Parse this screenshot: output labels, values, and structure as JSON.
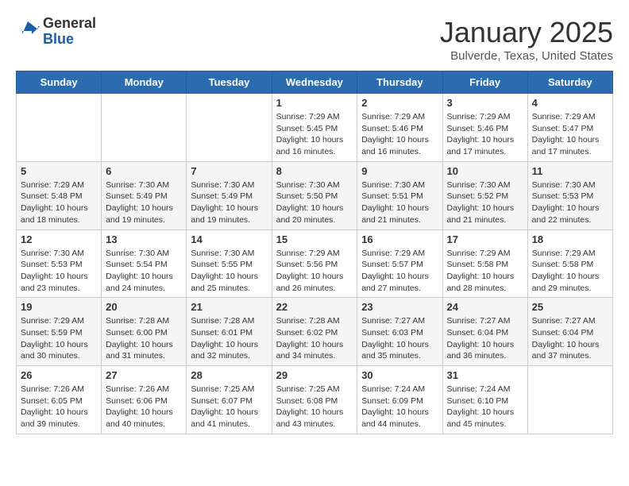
{
  "header": {
    "logo_general": "General",
    "logo_blue": "Blue",
    "month_title": "January 2025",
    "location": "Bulverde, Texas, United States"
  },
  "days_of_week": [
    "Sunday",
    "Monday",
    "Tuesday",
    "Wednesday",
    "Thursday",
    "Friday",
    "Saturday"
  ],
  "weeks": [
    [
      {
        "day": "",
        "info": ""
      },
      {
        "day": "",
        "info": ""
      },
      {
        "day": "",
        "info": ""
      },
      {
        "day": "1",
        "info": "Sunrise: 7:29 AM\nSunset: 5:45 PM\nDaylight: 10 hours\nand 16 minutes."
      },
      {
        "day": "2",
        "info": "Sunrise: 7:29 AM\nSunset: 5:46 PM\nDaylight: 10 hours\nand 16 minutes."
      },
      {
        "day": "3",
        "info": "Sunrise: 7:29 AM\nSunset: 5:46 PM\nDaylight: 10 hours\nand 17 minutes."
      },
      {
        "day": "4",
        "info": "Sunrise: 7:29 AM\nSunset: 5:47 PM\nDaylight: 10 hours\nand 17 minutes."
      }
    ],
    [
      {
        "day": "5",
        "info": "Sunrise: 7:29 AM\nSunset: 5:48 PM\nDaylight: 10 hours\nand 18 minutes."
      },
      {
        "day": "6",
        "info": "Sunrise: 7:30 AM\nSunset: 5:49 PM\nDaylight: 10 hours\nand 19 minutes."
      },
      {
        "day": "7",
        "info": "Sunrise: 7:30 AM\nSunset: 5:49 PM\nDaylight: 10 hours\nand 19 minutes."
      },
      {
        "day": "8",
        "info": "Sunrise: 7:30 AM\nSunset: 5:50 PM\nDaylight: 10 hours\nand 20 minutes."
      },
      {
        "day": "9",
        "info": "Sunrise: 7:30 AM\nSunset: 5:51 PM\nDaylight: 10 hours\nand 21 minutes."
      },
      {
        "day": "10",
        "info": "Sunrise: 7:30 AM\nSunset: 5:52 PM\nDaylight: 10 hours\nand 21 minutes."
      },
      {
        "day": "11",
        "info": "Sunrise: 7:30 AM\nSunset: 5:53 PM\nDaylight: 10 hours\nand 22 minutes."
      }
    ],
    [
      {
        "day": "12",
        "info": "Sunrise: 7:30 AM\nSunset: 5:53 PM\nDaylight: 10 hours\nand 23 minutes."
      },
      {
        "day": "13",
        "info": "Sunrise: 7:30 AM\nSunset: 5:54 PM\nDaylight: 10 hours\nand 24 minutes."
      },
      {
        "day": "14",
        "info": "Sunrise: 7:30 AM\nSunset: 5:55 PM\nDaylight: 10 hours\nand 25 minutes."
      },
      {
        "day": "15",
        "info": "Sunrise: 7:29 AM\nSunset: 5:56 PM\nDaylight: 10 hours\nand 26 minutes."
      },
      {
        "day": "16",
        "info": "Sunrise: 7:29 AM\nSunset: 5:57 PM\nDaylight: 10 hours\nand 27 minutes."
      },
      {
        "day": "17",
        "info": "Sunrise: 7:29 AM\nSunset: 5:58 PM\nDaylight: 10 hours\nand 28 minutes."
      },
      {
        "day": "18",
        "info": "Sunrise: 7:29 AM\nSunset: 5:58 PM\nDaylight: 10 hours\nand 29 minutes."
      }
    ],
    [
      {
        "day": "19",
        "info": "Sunrise: 7:29 AM\nSunset: 5:59 PM\nDaylight: 10 hours\nand 30 minutes."
      },
      {
        "day": "20",
        "info": "Sunrise: 7:28 AM\nSunset: 6:00 PM\nDaylight: 10 hours\nand 31 minutes."
      },
      {
        "day": "21",
        "info": "Sunrise: 7:28 AM\nSunset: 6:01 PM\nDaylight: 10 hours\nand 32 minutes."
      },
      {
        "day": "22",
        "info": "Sunrise: 7:28 AM\nSunset: 6:02 PM\nDaylight: 10 hours\nand 34 minutes."
      },
      {
        "day": "23",
        "info": "Sunrise: 7:27 AM\nSunset: 6:03 PM\nDaylight: 10 hours\nand 35 minutes."
      },
      {
        "day": "24",
        "info": "Sunrise: 7:27 AM\nSunset: 6:04 PM\nDaylight: 10 hours\nand 36 minutes."
      },
      {
        "day": "25",
        "info": "Sunrise: 7:27 AM\nSunset: 6:04 PM\nDaylight: 10 hours\nand 37 minutes."
      }
    ],
    [
      {
        "day": "26",
        "info": "Sunrise: 7:26 AM\nSunset: 6:05 PM\nDaylight: 10 hours\nand 39 minutes."
      },
      {
        "day": "27",
        "info": "Sunrise: 7:26 AM\nSunset: 6:06 PM\nDaylight: 10 hours\nand 40 minutes."
      },
      {
        "day": "28",
        "info": "Sunrise: 7:25 AM\nSunset: 6:07 PM\nDaylight: 10 hours\nand 41 minutes."
      },
      {
        "day": "29",
        "info": "Sunrise: 7:25 AM\nSunset: 6:08 PM\nDaylight: 10 hours\nand 43 minutes."
      },
      {
        "day": "30",
        "info": "Sunrise: 7:24 AM\nSunset: 6:09 PM\nDaylight: 10 hours\nand 44 minutes."
      },
      {
        "day": "31",
        "info": "Sunrise: 7:24 AM\nSunset: 6:10 PM\nDaylight: 10 hours\nand 45 minutes."
      },
      {
        "day": "",
        "info": ""
      }
    ]
  ]
}
